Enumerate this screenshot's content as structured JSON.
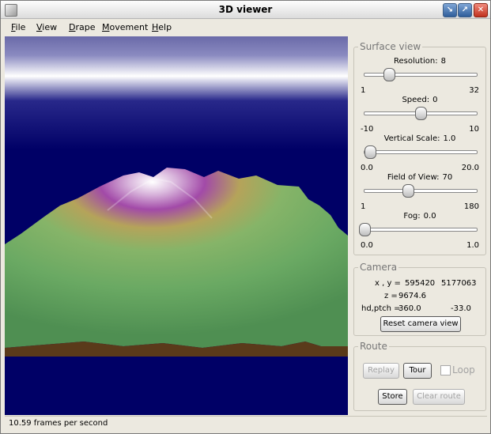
{
  "window": {
    "title": "3D viewer"
  },
  "menu": [
    {
      "key": "file",
      "accel": "F",
      "rest": "ile"
    },
    {
      "key": "view",
      "accel": "V",
      "rest": "iew"
    },
    {
      "key": "drape",
      "accel": "D",
      "rest": "rape"
    },
    {
      "key": "movement",
      "accel": "M",
      "rest": "ovement"
    },
    {
      "key": "help",
      "accel": "H",
      "rest": "elp"
    }
  ],
  "surface_view": {
    "title": "Surface view",
    "sliders": [
      {
        "key": "resolution",
        "label": "Resolution:",
        "value": "8",
        "min": "1",
        "max": "32",
        "level": 0.22
      },
      {
        "key": "speed",
        "label": "Speed:",
        "value": "0",
        "min": "-10",
        "max": "10",
        "level": 0.5
      },
      {
        "key": "vertical-scale",
        "label": "Vertical Scale:",
        "value": "1.0",
        "min": "0.0",
        "max": "20.0",
        "level": 0.05
      },
      {
        "key": "field-of-view",
        "label": "Field of View:",
        "value": "70",
        "min": "1",
        "max": "180",
        "level": 0.385
      },
      {
        "key": "fog",
        "label": "Fog:",
        "value": "0.0",
        "min": "0.0",
        "max": "1.0",
        "level": 0.0
      }
    ]
  },
  "camera": {
    "title": "Camera",
    "xy_label": "x , y =",
    "x": "595420",
    "y": "5177063",
    "z_label": "z =",
    "z": "9674.6",
    "hdptch_label": "hd,ptch =",
    "heading": "360.0",
    "pitch": "-33.0",
    "reset_label": "Reset camera view"
  },
  "route": {
    "title": "Route",
    "replay_label": "Replay",
    "tour_label": "Tour",
    "loop_label": "Loop",
    "store_label": "Store",
    "clear_label": "Clear route"
  },
  "status": {
    "text": "10.59 frames per second"
  },
  "colors": {
    "sky": "#000066",
    "ground": "#5a3a1a",
    "terrain": "#6fae68",
    "peak": "#a040a8"
  }
}
